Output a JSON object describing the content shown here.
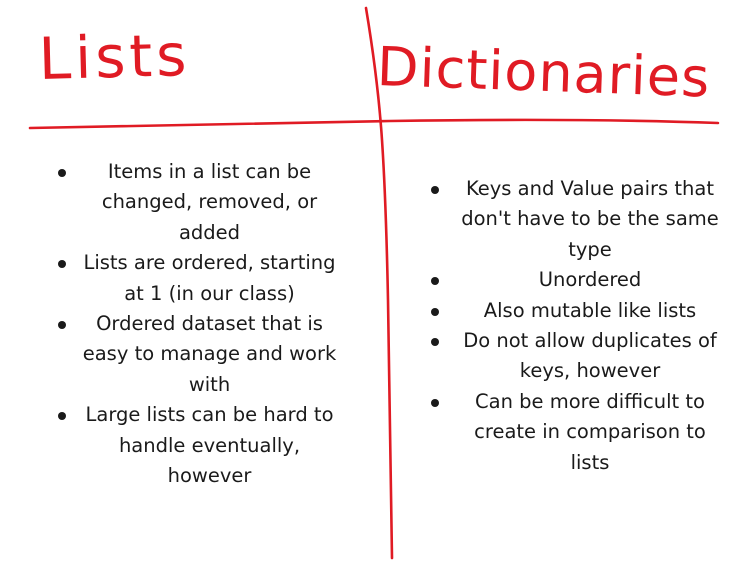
{
  "headings": {
    "lists": "Lists",
    "dictionaries": "Dictionaries"
  },
  "colors": {
    "ink": "#e01b24",
    "text": "#1a1a1a",
    "background": "#ffffff"
  },
  "lists_column": {
    "items": [
      "Items in a list can be changed, removed, or added",
      "Lists are ordered, starting at 1 (in our class)",
      "Ordered dataset that is easy to manage and work with",
      "Large lists can be hard to handle eventually, however"
    ]
  },
  "dictionaries_column": {
    "items": [
      "Keys and Value pairs that don't have to be the same type",
      "Unordered",
      "Also mutable like lists",
      "Do not allow duplicates of keys, however",
      "Can be more difficult to create in comparison to lists"
    ]
  }
}
